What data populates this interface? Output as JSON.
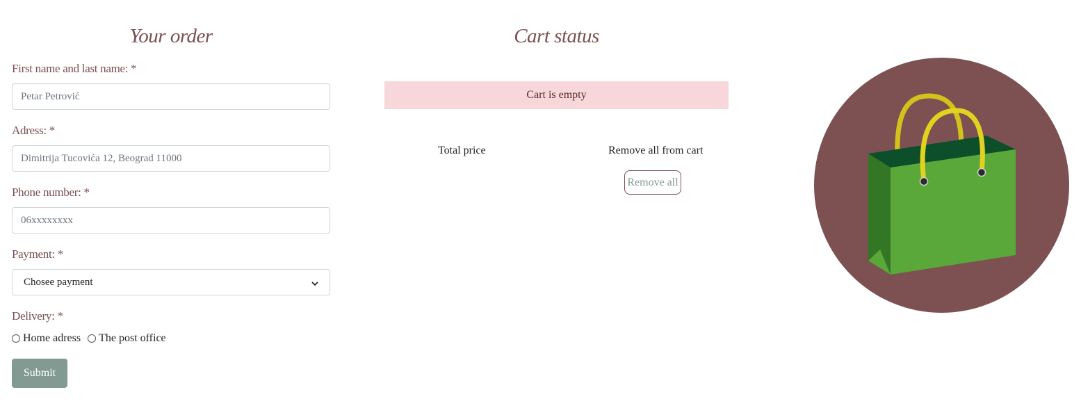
{
  "order": {
    "heading": "Your order",
    "name_label": "First name and last name: *",
    "name_placeholder": "Petar Petrović",
    "address_label": "Adress: *",
    "address_placeholder": "Dimitrija Tucovića 12, Beograd 11000",
    "phone_label": "Phone number: *",
    "phone_placeholder": "06xxxxxxxx",
    "payment_label": "Payment: *",
    "payment_selected": "Chosee payment",
    "delivery_label": "Delivery: *",
    "delivery_options": [
      "Home adress",
      "The post office"
    ],
    "submit_label": "Submit"
  },
  "cart": {
    "heading": "Cart status",
    "empty_message": "Cart is empty",
    "total_price_label": "Total price",
    "remove_all_text": "Remove all from cart",
    "remove_all_button": "Remove all"
  },
  "image": {
    "icon": "shopping-bag-icon",
    "circle_color": "#7d5052",
    "bag_color": "#5ba83a"
  },
  "colors": {
    "accent": "#7b4f50",
    "submit_bg": "#829a92",
    "empty_alert_bg": "#f7d7da"
  }
}
